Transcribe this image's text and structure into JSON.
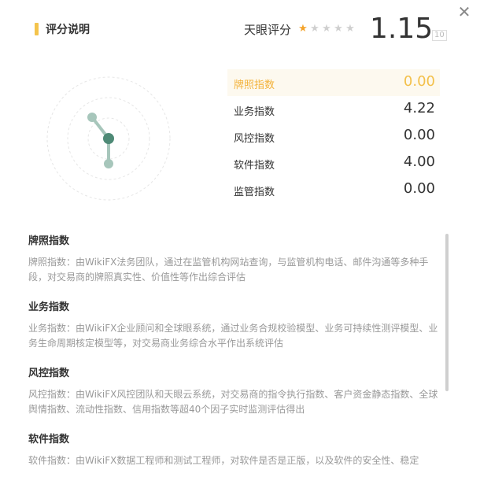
{
  "header": {
    "title": "评分说明",
    "score_label": "天眼评分",
    "score_value": "1.15",
    "score_max": "10",
    "stars_filled": 1,
    "stars_total": 5
  },
  "close_icon": "close-icon",
  "indices": [
    {
      "name": "牌照指数",
      "value": "0.00",
      "highlight": true
    },
    {
      "name": "业务指数",
      "value": "4.22",
      "highlight": false
    },
    {
      "name": "风控指数",
      "value": "0.00",
      "highlight": false
    },
    {
      "name": "软件指数",
      "value": "4.00",
      "highlight": false
    },
    {
      "name": "监管指数",
      "value": "0.00",
      "highlight": false
    }
  ],
  "descriptions": [
    {
      "title": "牌照指数",
      "text": "牌照指数：由WikiFX法务团队，通过在监管机构网站查询，与监管机构电话、邮件沟通等多种手段，对交易商的牌照真实性、价值性等作出综合评估"
    },
    {
      "title": "业务指数",
      "text": "业务指数：由WikiFX企业顾问和全球眼系统，通过业务合规校验模型、业务可持续性测评模型、业务生命周期核定模型等，对交易商业务综合水平作出系统评估"
    },
    {
      "title": "风控指数",
      "text": "风控指数：由WikiFX风控团队和天眼云系统，对交易商的指令执行指数、客户资金静态指数、全球舆情指数、流动性指数、信用指数等超40个因子实时监测评估得出"
    },
    {
      "title": "软件指数",
      "text": "软件指数：由WikiFX数据工程师和测试工程师，对软件是否是正版，以及软件的安全性、稳定"
    }
  ],
  "colors": {
    "accent": "#f4c44c",
    "highlight_text": "#f3b23a",
    "radar_dot": "#4e8a76"
  }
}
